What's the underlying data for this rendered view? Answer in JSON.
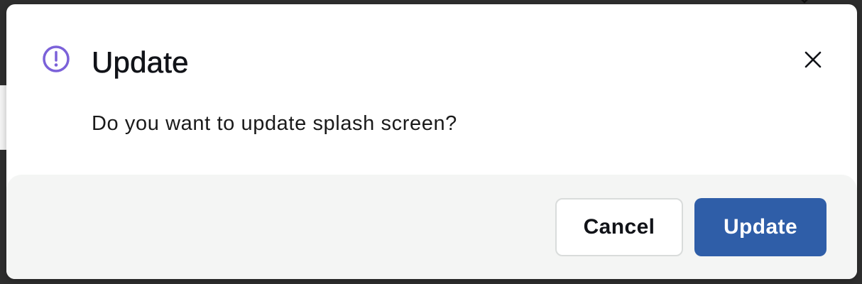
{
  "dialog": {
    "title": "Update",
    "message": "Do you want to update splash screen?",
    "icons": {
      "alert": "exclamation-circle-icon",
      "close": "close-icon"
    },
    "buttons": {
      "cancel_label": "Cancel",
      "confirm_label": "Update"
    },
    "colors": {
      "alert_icon": "#7b61d9",
      "confirm_button": "#2f5ea8",
      "footer_background": "#f4f5f4"
    }
  }
}
